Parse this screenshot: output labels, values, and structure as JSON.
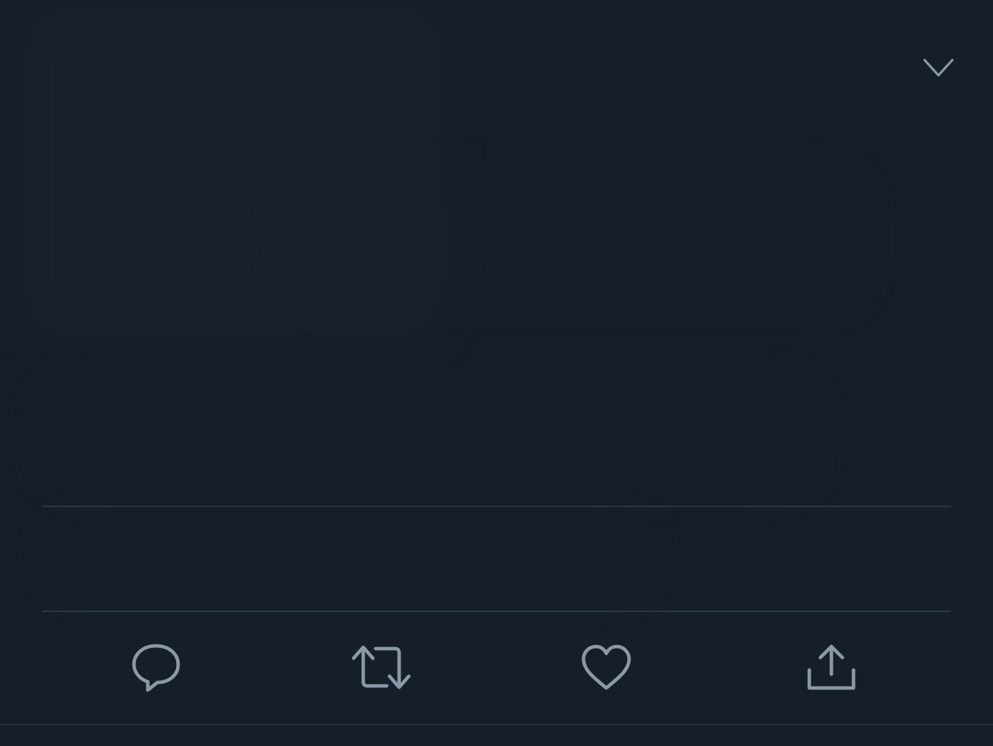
{
  "colors": {
    "background": "#161e2a",
    "icon": "#8b98a5",
    "divider": "#2b3847"
  },
  "header": {
    "menu_icon": "chevron-down-icon"
  },
  "actions": [
    {
      "icon": "reply-icon",
      "label": ""
    },
    {
      "icon": "retweet-icon",
      "label": ""
    },
    {
      "icon": "like-icon",
      "label": ""
    },
    {
      "icon": "share-icon",
      "label": ""
    }
  ]
}
